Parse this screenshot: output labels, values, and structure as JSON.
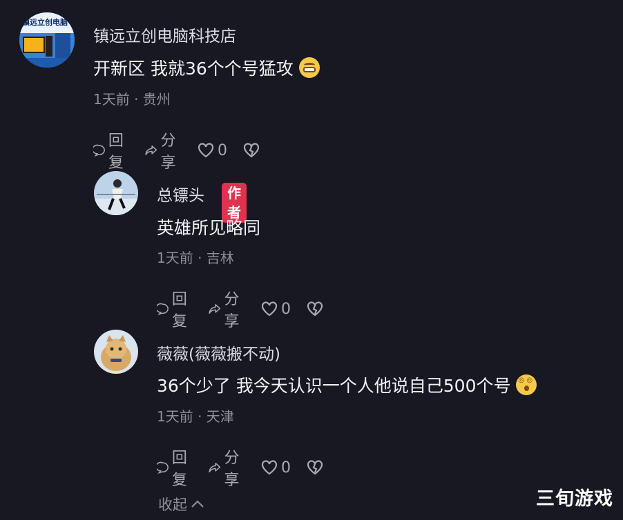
{
  "comments": [
    {
      "username": "镇远立创电脑科技店",
      "text": "开新区 我就36个个号猛攻",
      "emoji": "grin-emoji",
      "meta": "1天前 · 贵州",
      "reply_label": "回复",
      "share_label": "分享",
      "like_count": "0",
      "avatar_text": "镇远立创电脑"
    },
    {
      "username": "总镖头",
      "badge": "作者",
      "text": "英雄所见略同",
      "meta": "1天前 · 吉林",
      "reply_label": "回复",
      "share_label": "分享",
      "like_count": "0"
    },
    {
      "username": "薇薇(薇薇搬不动)",
      "text": "36个少了 我今天认识一个人他说自己500个号",
      "emoji": "dizzy-emoji",
      "meta": "1天前 · 天津",
      "reply_label": "回复",
      "share_label": "分享",
      "like_count": "0"
    }
  ],
  "collapse_label": "收起",
  "watermark": "三旬游戏",
  "colors": {
    "background": "#171821",
    "author_badge": "#e0314f"
  }
}
